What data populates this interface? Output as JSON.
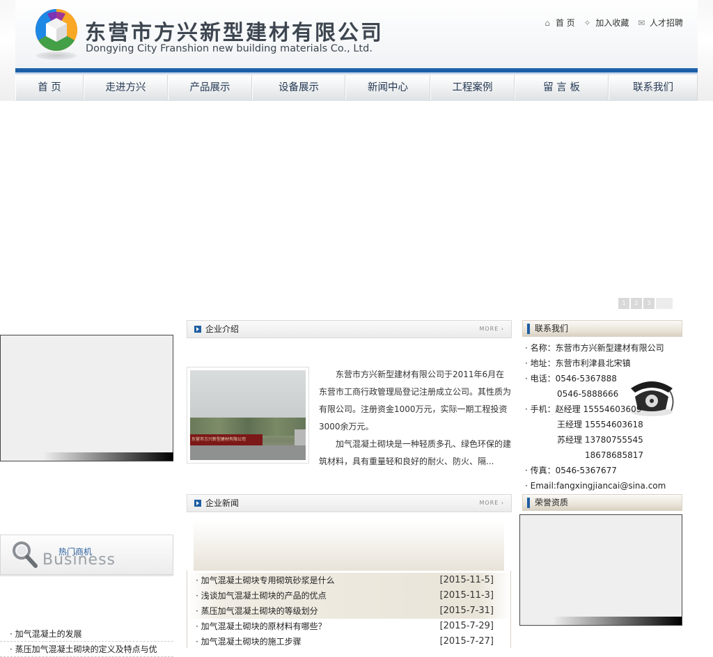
{
  "header": {
    "company_cn": "东营市方兴新型建材有限公司",
    "company_en": "Dongying City Franshion new building materials Co., Ltd.",
    "top_links": [
      {
        "icon": "home-icon",
        "label": "首 页"
      },
      {
        "icon": "favorite-icon",
        "label": "加入收藏"
      },
      {
        "icon": "mail-icon",
        "label": "人才招聘"
      }
    ]
  },
  "nav": {
    "items": [
      "首 页",
      "走进方兴",
      "产品展示",
      "设备展示",
      "新闻中心",
      "工程案例",
      "留 言 板",
      "联系我们"
    ]
  },
  "banner": {
    "pages": [
      "1",
      "2",
      "3"
    ]
  },
  "business": {
    "label_cn": "热门商机",
    "label_en": "Business",
    "items": [
      "加气混凝土的发展",
      "蒸压加气混凝土砌块的定义及特点与优"
    ]
  },
  "intro": {
    "title": "企业介绍",
    "more": "MORE ›",
    "photo_sign": "东营市方兴新型建材有限公司",
    "paragraphs": [
      "东营市方兴新型建材有限公司于2011年6月在东营市工商行政管理局登记注册成立公司。其性质为有限公司。注册资金1000万元，实际一期工程投资3000余万元。",
      "加气混凝土砌块是一种轻质多孔、绿色环保的建筑材料，具有重量轻和良好的耐火、防火、隔..."
    ]
  },
  "contact": {
    "title": "联系我们",
    "name": "· 名称：东营市方兴新型建材有限公司",
    "address": "· 地址：东营市利津县北宋镇",
    "phone1": "· 电话：0546-5367888",
    "phone2": "0546-5888666",
    "mobile1": "· 手机：赵经理 15554603609",
    "mobile2": "王经理 15554603618",
    "mobile3": "苏经理 13780755545",
    "mobile4": "18678685817",
    "fax": "· 传真：0546-5367677",
    "email": "· Email:fangxingjiancai@sina.com"
  },
  "news": {
    "title": "企业新闻",
    "more": "MORE ›",
    "items": [
      {
        "title": "· 加气混凝土砌块专用砌筑砂浆是什么",
        "date": "[2015-11-5]"
      },
      {
        "title": "· 浅谈加气混凝土砌块的产品的优点",
        "date": "[2015-11-3]"
      },
      {
        "title": "· 蒸压加气混凝土砌块的等级划分",
        "date": "[2015-7-31]"
      },
      {
        "title": "· 加气混凝土砌块的原材料有哪些？",
        "date": "[2015-7-29]"
      },
      {
        "title": "· 加气混凝土砌块的施工步骤",
        "date": "[2015-7-27]"
      }
    ]
  },
  "honors": {
    "title": "荣誉资质"
  },
  "colors": {
    "brand_blue": "#1b5fa7",
    "nav_text": "#263a55",
    "accent_tan": "#e7e1d5"
  }
}
